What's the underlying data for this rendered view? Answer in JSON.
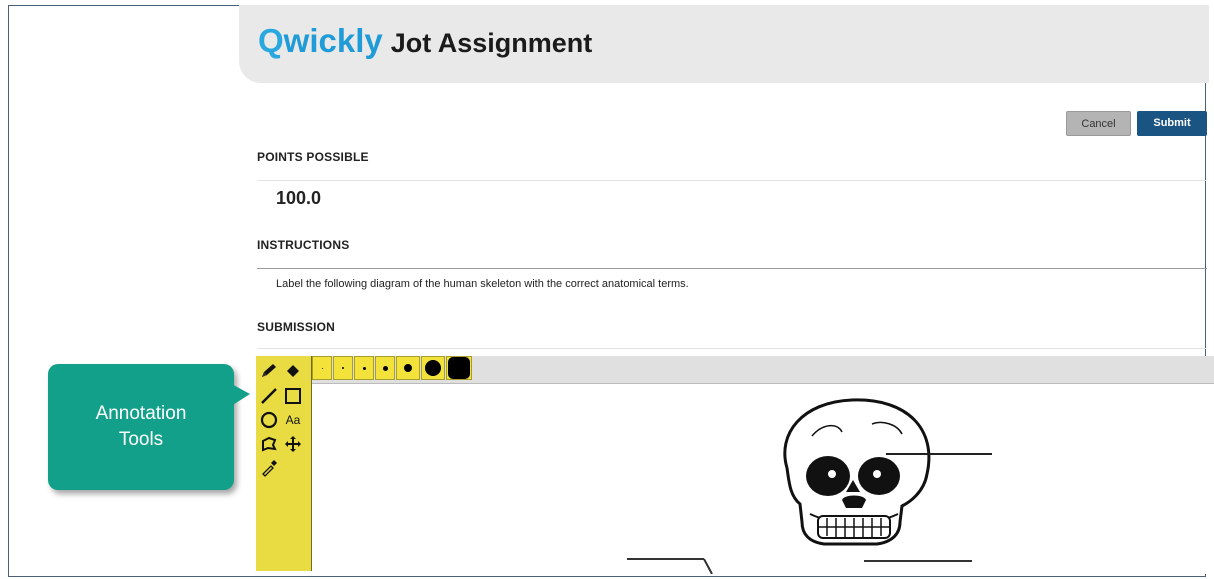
{
  "header": {
    "brand_part1": "Q",
    "brand_part2": "wickly",
    "title": "Jot Assignment"
  },
  "buttons": {
    "cancel_label": "Cancel",
    "submit_label": "Submit"
  },
  "sections": {
    "points_label": "POINTS POSSIBLE",
    "points_value": "100.0",
    "instructions_label": "INSTRUCTIONS",
    "instructions_text": "Label the following diagram of the human skeleton with the correct anatomical terms.",
    "submission_label": "SUBMISSION"
  },
  "annotation_panel": {
    "tools": [
      "pencil-icon",
      "eraser-icon",
      "line-icon",
      "rectangle-icon",
      "ellipse-icon",
      "text-icon",
      "lasso-icon",
      "move-icon",
      "eyedropper-icon"
    ],
    "text_tool_label": "Aa",
    "brush_sizes": [
      "1",
      "2",
      "3",
      "4",
      "5",
      "6",
      "7"
    ],
    "panel_color": "#e8dc42"
  },
  "callout": {
    "line1": "Annotation",
    "line2": "Tools",
    "color": "#12a08a"
  }
}
